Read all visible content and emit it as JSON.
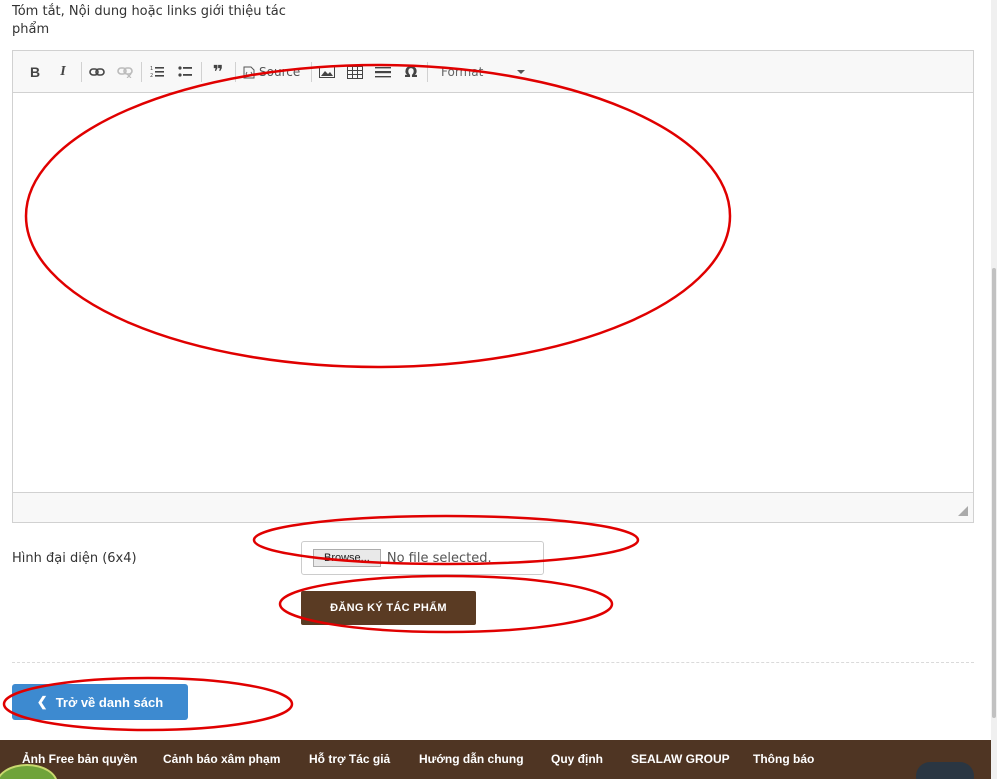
{
  "form": {
    "summary_label": "Tóm tắt, Nội dung hoặc links giới thiệu tác phẩm",
    "avatar_label": "Hình đại diện (6x4)",
    "file_input": {
      "browse_label": "Browse...",
      "status": "No file selected."
    },
    "submit_label": "ĐĂNG KÝ TÁC PHẨM",
    "back_label": "Trở về danh sách"
  },
  "editor": {
    "toolbar": {
      "bold": "B",
      "italic": "I",
      "source_label": "Source",
      "format_label": "Format",
      "quote": "❞",
      "special_char": "Ω"
    }
  },
  "footer": {
    "links": [
      "Ảnh Free bản quyền",
      "Cảnh báo xâm phạm",
      "Hỗ trợ Tác giả",
      "Hướng dẫn chung",
      "Quy định",
      "SEALAW GROUP",
      "Thông báo"
    ]
  },
  "colors": {
    "submit_bg": "#5a3b23",
    "back_bg": "#3d8ad0",
    "footer_bg": "#4f3523",
    "annotation": "#e00000"
  }
}
